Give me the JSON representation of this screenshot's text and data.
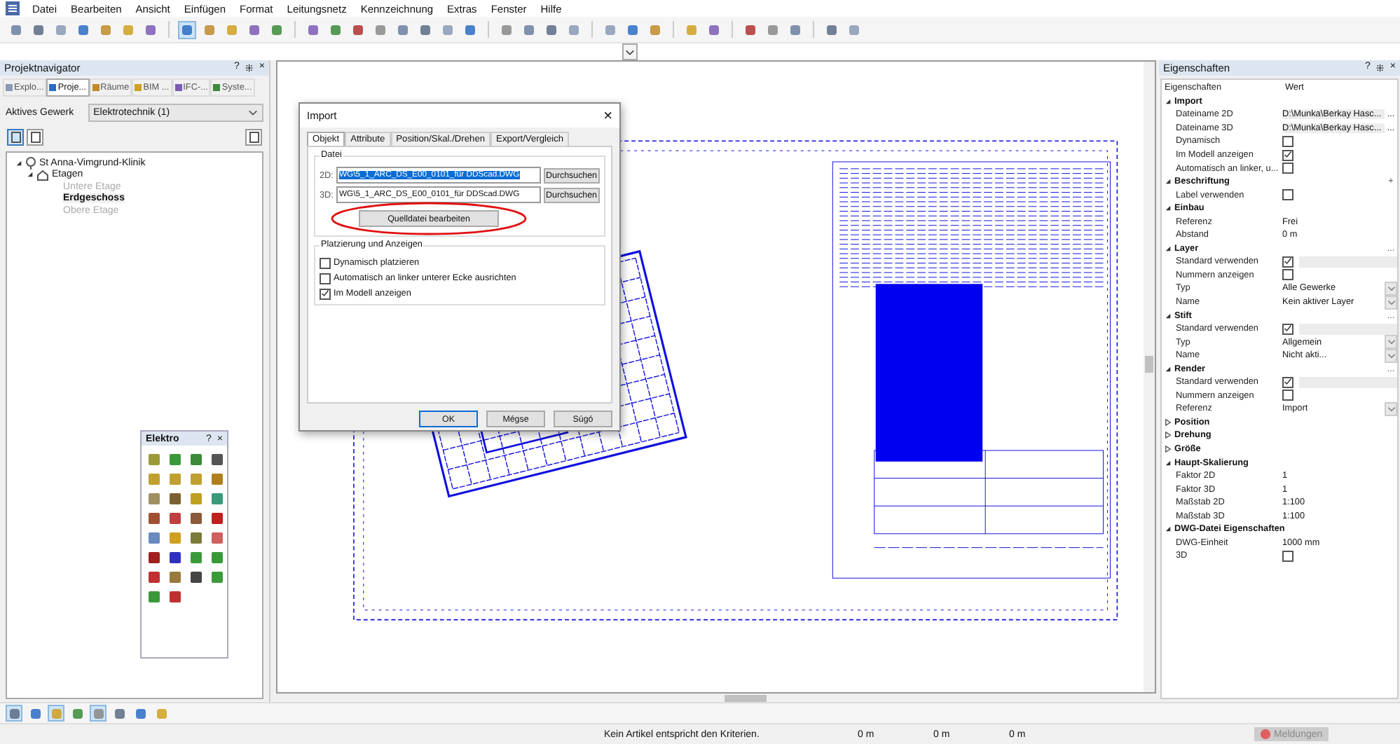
{
  "menu": [
    "Datei",
    "Bearbeiten",
    "Ansicht",
    "Einfügen",
    "Format",
    "Leitungsnetz",
    "Kennzeichnung",
    "Extras",
    "Fenster",
    "Hilfe"
  ],
  "toolbar": {
    "icon_groups": [
      [
        {
          "selected": false
        },
        {
          "selected": false
        },
        {
          "selected": false
        },
        {
          "selected": false
        },
        {
          "selected": false
        },
        {
          "selected": false
        },
        {
          "selected": false
        }
      ],
      [
        {
          "selected": true
        },
        {
          "selected": false
        },
        {
          "selected": false
        },
        {
          "selected": false
        },
        {
          "selected": false
        }
      ],
      [
        {
          "selected": false
        },
        {
          "selected": false
        },
        {
          "selected": false
        },
        {
          "selected": false
        },
        {
          "selected": false
        },
        {
          "selected": false
        },
        {
          "selected": false
        },
        {
          "selected": false
        }
      ],
      [
        {
          "selected": false
        },
        {
          "selected": false
        },
        {
          "selected": false
        },
        {
          "selected": false
        }
      ],
      [
        {
          "selected": false
        },
        {
          "selected": false
        },
        {
          "selected": false
        }
      ],
      [
        {
          "selected": false
        },
        {
          "selected": false
        }
      ],
      [
        {
          "selected": false
        },
        {
          "selected": false
        },
        {
          "selected": false
        }
      ],
      [
        {
          "selected": false
        },
        {
          "selected": false
        }
      ]
    ]
  },
  "left_panel": {
    "title": "Projektnavigator",
    "title_buttons": [
      "?",
      "⁜",
      "×"
    ],
    "tabs": [
      {
        "label": "Explo...",
        "selected": false
      },
      {
        "label": "Proje...",
        "selected": true
      },
      {
        "label": "Räume",
        "selected": false
      },
      {
        "label": "BIM ...",
        "selected": false
      },
      {
        "label": "IFC-...",
        "selected": false
      },
      {
        "label": "Syste...",
        "selected": false
      }
    ],
    "gewerk_label": "Aktives Gewerk",
    "gewerk_value": "Elektrotechnik (1)",
    "view_buttons": [
      {
        "selected": true
      },
      {
        "selected": false
      }
    ],
    "tree": [
      {
        "label": "St Anna-Vimgrund-Klinik",
        "kind": "building",
        "expanded": true,
        "children": [
          {
            "label": "Etagen",
            "kind": "folder",
            "expanded": true,
            "children": [
              {
                "label": "Untere Etage",
                "kind": "floor",
                "selected": false
              },
              {
                "label": "Erdgeschoss",
                "kind": "floor",
                "selected": true
              },
              {
                "label": "Obere Etage",
                "kind": "floor",
                "selected": false
              }
            ]
          }
        ]
      }
    ]
  },
  "dialog": {
    "title": "Import",
    "close": "×",
    "tabs": [
      {
        "label": "Objekt",
        "selected": true
      },
      {
        "label": "Attribute",
        "selected": false
      },
      {
        "label": "Position/Skal./Drehen",
        "selected": false
      },
      {
        "label": "Export/Vergleich",
        "selected": false
      }
    ],
    "file_group": {
      "title": "Datei",
      "rows": [
        {
          "label": "2D:",
          "value": "WG\\5_1_ARC_DS_E00_0101_für DDScad.DWG",
          "selected": true,
          "button": "Durchsuchen"
        },
        {
          "label": "3D:",
          "value": "WG\\5_1_ARC_DS_E00_0101_für DDScad.DWG",
          "selected": false,
          "button": "Durchsuchen"
        }
      ],
      "edit_button": {
        "label": "Quelldatei bearbeiten",
        "highlighted": true
      }
    },
    "placement_group": {
      "title": "Platzierung und Anzeigen",
      "options": [
        {
          "label": "Dynamisch platzieren",
          "checked": false
        },
        {
          "label": "Automatisch an linker unterer Ecke ausrichten",
          "checked": false
        },
        {
          "label": "Im Modell anzeigen",
          "checked": true
        }
      ]
    },
    "buttons": [
      {
        "label": "OK",
        "default": true
      },
      {
        "label": "Mégse",
        "default": false
      },
      {
        "label": "Súgó",
        "default": false
      }
    ]
  },
  "palette": {
    "title": "Elektro",
    "title_buttons": [
      "?",
      "×"
    ]
  },
  "properties": {
    "title": "Eigenschaften",
    "title_buttons": [
      "?",
      "⁜",
      "×"
    ],
    "columns": [
      "Eigenschaften",
      "Wert"
    ],
    "groups": [
      {
        "name": "Import",
        "expanded": true,
        "rows": [
          {
            "kind": "file",
            "label": "Dateiname 2D",
            "value": "D:\\Munka\\Berkay Hasc...",
            "button": "..."
          },
          {
            "kind": "file",
            "label": "Dateiname 3D",
            "value": "D:\\Munka\\Berkay Hasc...",
            "button": "..."
          },
          {
            "kind": "checkbox",
            "label": "Dynamisch",
            "checked": false
          },
          {
            "kind": "checkbox",
            "label": "Im Modell anzeigen",
            "checked": true
          },
          {
            "kind": "checkbox",
            "label": "Automatisch an linker, u...",
            "checked": false
          }
        ]
      },
      {
        "name": "Beschriftung",
        "expanded": true,
        "button": "+",
        "rows": [
          {
            "kind": "checkbox",
            "label": "Label verwenden",
            "checked": false
          }
        ]
      },
      {
        "name": "Einbau",
        "expanded": true,
        "rows": [
          {
            "kind": "text",
            "label": "Referenz",
            "value": "Frei"
          },
          {
            "kind": "text",
            "label": "Abstand",
            "value": "0 m"
          }
        ]
      },
      {
        "name": "Layer",
        "expanded": true,
        "button": "...",
        "rows": [
          {
            "kind": "check_field",
            "label": "Standard verwenden",
            "checked": true
          },
          {
            "kind": "checkbox",
            "label": "Nummern anzeigen",
            "checked": false
          },
          {
            "kind": "select",
            "label": "Typ",
            "value": "Alle Gewerke"
          },
          {
            "kind": "select",
            "label": "Name",
            "value": "Kein aktiver Layer"
          }
        ]
      },
      {
        "name": "Stift",
        "expanded": true,
        "button": "...",
        "rows": [
          {
            "kind": "check_field",
            "label": "Standard verwenden",
            "checked": true
          },
          {
            "kind": "select",
            "label": "Typ",
            "value": "Allgemein"
          },
          {
            "kind": "select",
            "label": "Name",
            "value": "Nicht akti..."
          }
        ]
      },
      {
        "name": "Render",
        "expanded": true,
        "button": "...",
        "rows": [
          {
            "kind": "check_field",
            "label": "Standard verwenden",
            "checked": true
          },
          {
            "kind": "checkbox",
            "label": "Nummern anzeigen",
            "checked": false
          },
          {
            "kind": "select",
            "label": "Referenz",
            "value": "Import"
          }
        ]
      },
      {
        "name": "Position",
        "expanded": false
      },
      {
        "name": "Drehung",
        "expanded": false
      },
      {
        "name": "Größe",
        "expanded": false
      },
      {
        "name": "Haupt-Skalierung",
        "expanded": true,
        "rows": [
          {
            "kind": "text",
            "label": "Faktor 2D",
            "value": "1"
          },
          {
            "kind": "text",
            "label": "Faktor 3D",
            "value": "1"
          },
          {
            "kind": "text",
            "label": "Maßstab 2D",
            "value": "1:100"
          },
          {
            "kind": "text",
            "label": "Maßstab 3D",
            "value": "1:100"
          }
        ]
      },
      {
        "name": "DWG-Datei Eigenschaften",
        "expanded": true,
        "rows": [
          {
            "kind": "text",
            "label": "DWG-Einheit",
            "value": "1000 mm"
          },
          {
            "kind": "checkbox",
            "label": "3D",
            "checked": false
          }
        ]
      }
    ]
  },
  "status_bar": {
    "tool_icons": [
      {
        "selected": true
      },
      {
        "selected": false
      },
      {
        "selected": true
      },
      {
        "selected": false
      },
      {
        "selected": true
      },
      {
        "selected": false
      },
      {
        "selected": false
      },
      {
        "selected": false
      }
    ],
    "message": "Kein Artikel entspricht den Kriterien.",
    "readings": [
      "0 m",
      "0 m",
      "0 m"
    ],
    "messages_button": "Meldungen"
  }
}
